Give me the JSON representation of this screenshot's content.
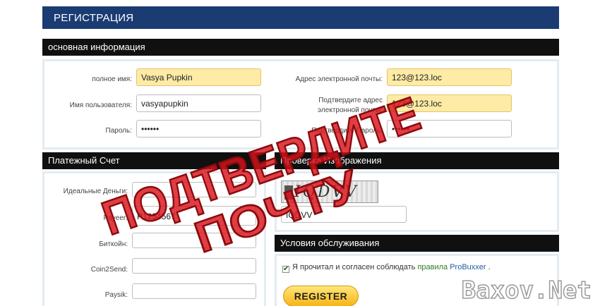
{
  "title": "РЕГИСТРАЦИЯ",
  "basic": {
    "header": "основная информация",
    "full_name": {
      "label": "полное имя:",
      "value": "Vasya Pupkin"
    },
    "username": {
      "label": "Имя пользователя:",
      "value": "vasyapupkin"
    },
    "password": {
      "label": "Пароль:",
      "value": "••••••"
    },
    "email": {
      "label": "Адрес электронной почты:",
      "value": "123@123.loc"
    },
    "confirm_email": {
      "label_line1": "Подтвердите адрес",
      "label_line2": "электронной почты:",
      "value": "123@123.loc"
    },
    "confirm_password": {
      "label": "Подтвердите Пароль:",
      "value": "••••••"
    }
  },
  "payment": {
    "header": "Платежный Счет",
    "perfect_money": {
      "label": "Идеальные Деньги:",
      "value": ""
    },
    "payeer": {
      "label": "Payeer:",
      "value": "P1234567"
    },
    "bitcoin": {
      "label": "Биткойн:",
      "value": ""
    },
    "coin2send": {
      "label": "Coin2Send:",
      "value": ""
    },
    "paysik": {
      "label": "Paysik:",
      "value": ""
    }
  },
  "captcha": {
    "header": "Проверка Изображения",
    "image_text": "IQDVV",
    "input_value": "IQDVV"
  },
  "terms": {
    "header": "Условия обслуживания",
    "checked": true,
    "check_mark": "✔",
    "text_before": "Я прочитал и согласен соблюдать ",
    "link": "правила",
    "text_mid": " ",
    "brand": "ProBuxxer",
    "text_after": " ."
  },
  "register_button": "REGISTER",
  "stamp": {
    "line1": "ПОДТВЕРДИТЕ",
    "line2": "ПОЧТУ",
    "color": "#d9141b"
  },
  "watermark": {
    "text": "Baxov.Net"
  },
  "colors": {
    "title_bar": "#1b3c73",
    "section_bar": "#101010",
    "highlight_input": "#fdeba6",
    "button": "#f6b515"
  }
}
